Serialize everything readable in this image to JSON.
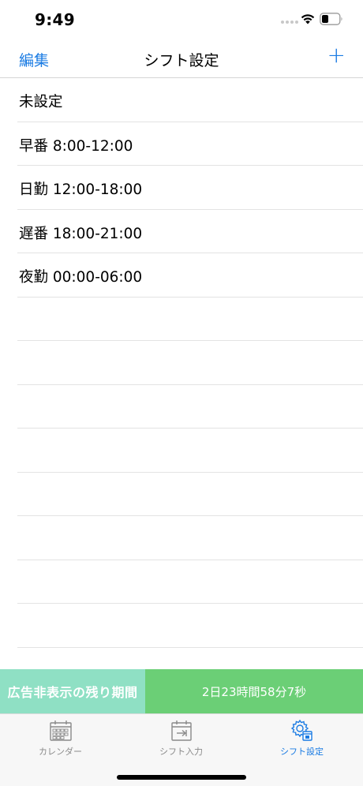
{
  "status_bar": {
    "time": "9:49",
    "icons": [
      "signal-dots-icon",
      "wifi-icon",
      "battery-icon"
    ]
  },
  "nav": {
    "edit_label": "編集",
    "title": "シフト設定",
    "add_label": "+"
  },
  "shifts": [
    {
      "label": "未設定"
    },
    {
      "label": "早番 8:00-12:00"
    },
    {
      "label": "日勤 12:00-18:00"
    },
    {
      "label": "遅番 18:00-21:00"
    },
    {
      "label": "夜勤 00:00-06:00"
    }
  ],
  "ad_banner": {
    "label": "広告非表示の残り期間",
    "remaining": "2日23時間58分7秒",
    "left_color": "#8fe0c4",
    "right_color": "#6bcf76"
  },
  "tabs": [
    {
      "label": "カレンダー",
      "icon": "calendar-icon",
      "active": false
    },
    {
      "label": "シフト入力",
      "icon": "shift-input-icon",
      "active": false
    },
    {
      "label": "シフト設定",
      "icon": "gear-settings-icon",
      "active": true
    }
  ],
  "colors": {
    "accent": "#1a7be3",
    "inactive": "#8a8a8a"
  }
}
